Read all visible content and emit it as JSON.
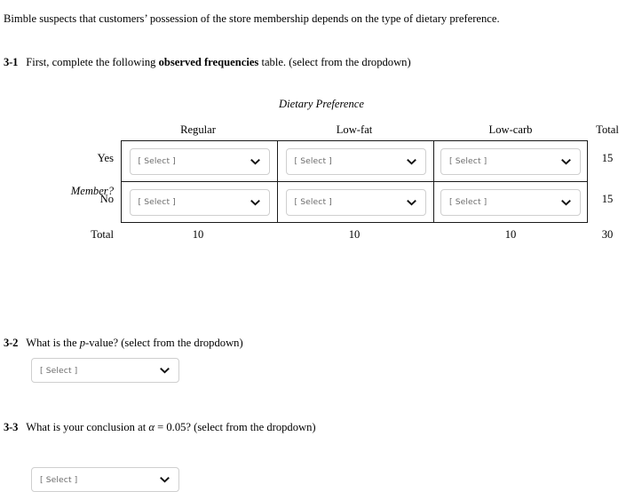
{
  "intro": {
    "text": "Bimble suspects that customers’ possession of the store membership depends on the type of dietary preference."
  },
  "questions": {
    "q31": {
      "number": "3-1",
      "before_bold": "First, complete the following ",
      "bold": "observed frequencies",
      "after_bold": " table. (select from the dropdown)"
    },
    "q32": {
      "number": "3-2",
      "before_italic": "What is the ",
      "italic": "p",
      "after_italic": "-value? (select from the dropdown)"
    },
    "q33": {
      "number": "3-3",
      "before_italic": "What is your conclusion at ",
      "italic": "α",
      "after_italic": " = 0.05? (select from the dropdown)"
    }
  },
  "table": {
    "group_title": "Dietary Preference",
    "row_group_label": "Member?",
    "total_header": "Total",
    "total_row_label": "Total",
    "column_headers": [
      "Regular",
      "Low-fat",
      "Low-carb"
    ],
    "row_labels": [
      "Yes",
      "No"
    ],
    "cells": [
      [
        "[ Select ]",
        "[ Select ]",
        "[ Select ]"
      ],
      [
        "[ Select ]",
        "[ Select ]",
        "[ Select ]"
      ]
    ],
    "row_totals": [
      "15",
      "15"
    ],
    "column_totals": [
      "10",
      "10",
      "10"
    ],
    "grand_total": "30"
  },
  "selects": {
    "pvalue": {
      "value": "[ Select ]"
    },
    "conclusion": {
      "value": "[ Select ]"
    }
  },
  "colors": {
    "border": "#1a1a1a",
    "select_border": "#cfcfcf",
    "placeholder_text": "#6c6c6c",
    "text": "#000000",
    "background": "#ffffff"
  }
}
